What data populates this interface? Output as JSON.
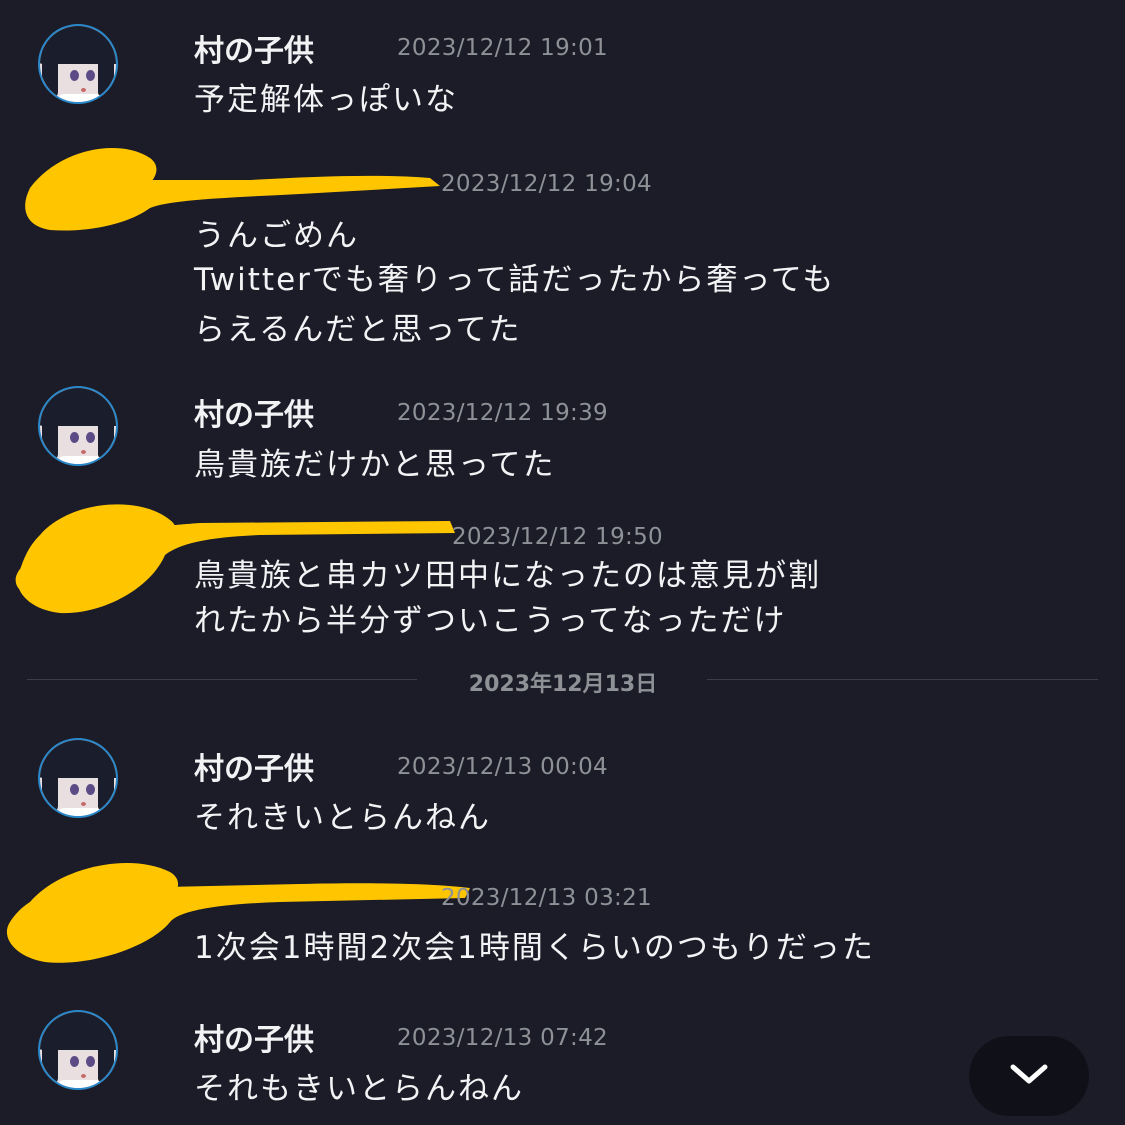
{
  "messages": [
    {
      "author": "村の子供",
      "time": "2023/12/12 19:01",
      "lines": [
        "予定解体っぽいな"
      ]
    },
    {
      "author": "",
      "time": "2023/12/12 19:04",
      "lines": [
        "うんごめん",
        "Twitterでも奢りって話だったから奢っても",
        "らえるんだと思ってた"
      ]
    },
    {
      "author": "村の子供",
      "time": "2023/12/12 19:39",
      "lines": [
        "鳥貴族だけかと思ってた"
      ]
    },
    {
      "author": "",
      "time": "2023/12/12 19:50",
      "lines": [
        "鳥貴族と串カツ田中になったのは意見が割",
        "れたから半分ずついこうってなっただけ"
      ]
    },
    {
      "author": "村の子供",
      "time": "2023/12/13 00:04",
      "lines": [
        "それきいとらんねん"
      ]
    },
    {
      "author": "",
      "time": "2023/12/13 03:21",
      "lines": [
        "1次会1時間2次会1時間くらいのつもりだった"
      ]
    },
    {
      "author": "村の子供",
      "time": "2023/12/13 07:42",
      "lines": [
        "それもきいとらんねん"
      ]
    }
  ],
  "date_divider": "2023年12月13日",
  "scroll_button_icon": "chevron-down-icon",
  "colors": {
    "background": "#1b1c27",
    "scribble": "#ffc600",
    "timestamp": "#8e9297"
  }
}
